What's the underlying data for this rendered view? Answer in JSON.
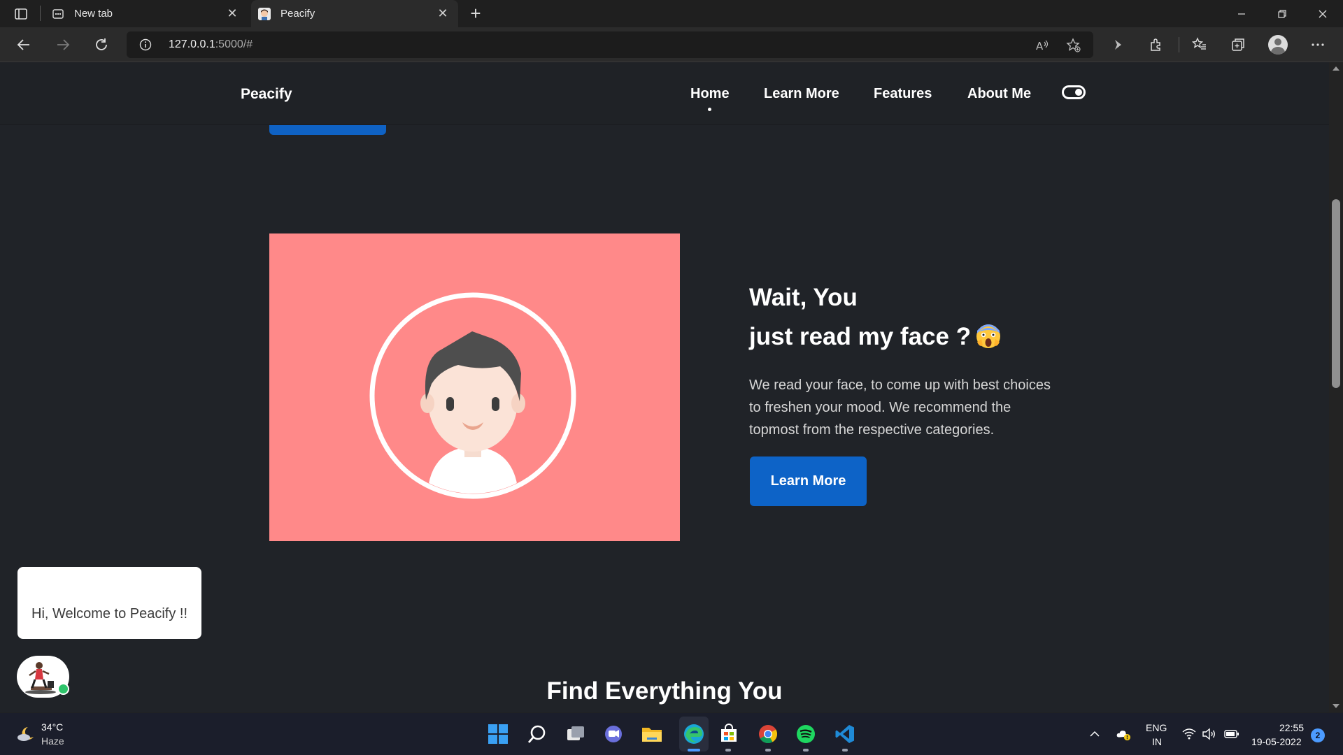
{
  "browser": {
    "tabs": [
      {
        "label": "New tab",
        "icon": "new-tab-page-icon",
        "active": false
      },
      {
        "label": "Peacify",
        "icon": "peacify-favicon",
        "active": true
      }
    ],
    "close_glyph": "✕",
    "new_tab_glyph": "+",
    "address": {
      "host": "127.0.0.1",
      "rest": ":5000/#"
    }
  },
  "site": {
    "brand": "Peacify",
    "nav": [
      "Home",
      "Learn More",
      "Features",
      "About Me"
    ],
    "active_nav": "Home",
    "theme_toggle": "on"
  },
  "hero": {
    "title_line1": "Wait, You",
    "title_line2": "just read my face ?",
    "title_emoji": "face-screaming-in-fear-emoji",
    "text": "We read your face, to come up with best choices to freshen your mood. We recommend the topmost from the respective categories.",
    "button": "Learn More",
    "image_bg": "#ff8989"
  },
  "section": {
    "title": "Find Everything You"
  },
  "chat": {
    "message": "Hi, Welcome to Peacify !!",
    "status": "online"
  },
  "taskbar": {
    "weather_temp": "34°C",
    "weather_desc": "Haze",
    "lang_line1": "ENG",
    "lang_line2": "IN",
    "time": "22:55",
    "date": "19-05-2022",
    "notifications": "2",
    "apps": [
      "start-icon",
      "search-icon",
      "task-view-icon",
      "chat-icon",
      "file-explorer-icon",
      "edge-icon",
      "store-icon",
      "chrome-icon",
      "spotify-icon",
      "vscode-icon"
    ]
  },
  "colors": {
    "accent": "#0d63c7",
    "page_bg": "#202328",
    "hero_image": "#ff8989"
  }
}
